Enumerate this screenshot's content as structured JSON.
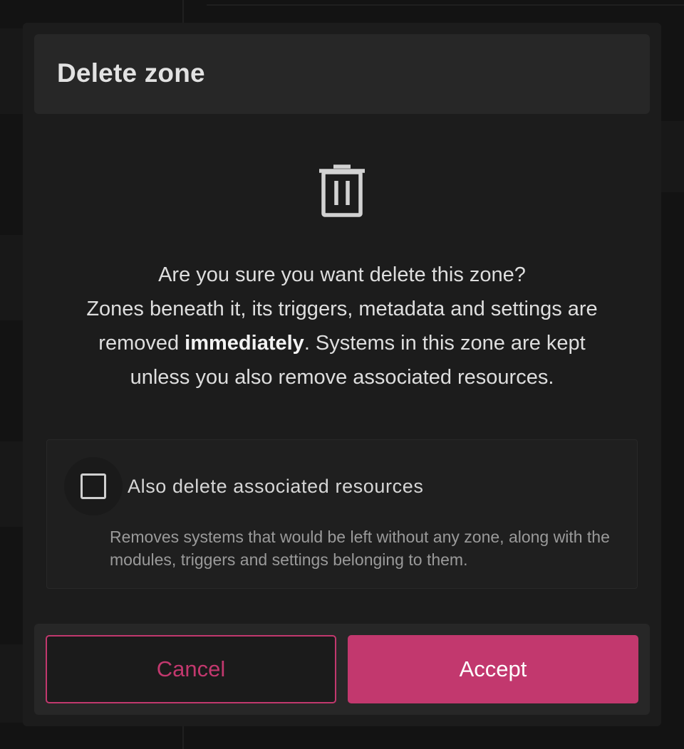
{
  "dialog": {
    "title": "Delete zone",
    "icon": "trash-icon",
    "message": {
      "line1": "Are you sure you want delete this zone?",
      "line2": "Zones beneath it, its triggers, metadata and settings are",
      "line3_before": "removed ",
      "line3_bold": "immediately",
      "line3_after": ". Systems in this zone are kept",
      "line4": "unless you also remove associated resources."
    },
    "option": {
      "checked": false,
      "label": "Also delete associated resources",
      "help": "Removes systems that would be left without any zone, along with the modules, triggers and settings belonging to them."
    },
    "buttons": {
      "cancel": "Cancel",
      "accept": "Accept"
    }
  },
  "colors": {
    "accent": "#c2386e",
    "modal_bg": "#1c1c1c",
    "header_bg": "#272727"
  }
}
